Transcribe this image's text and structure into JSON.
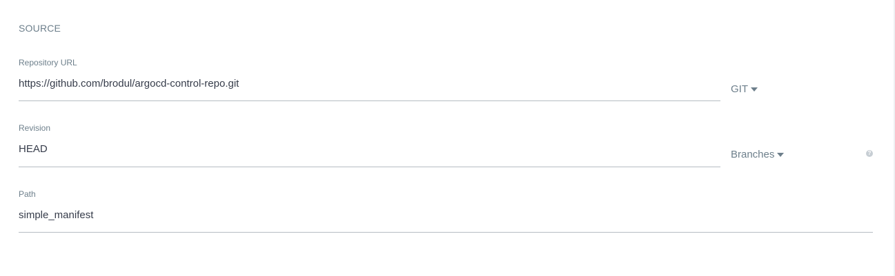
{
  "section": {
    "title": "SOURCE"
  },
  "fields": {
    "repo_url": {
      "label": "Repository URL",
      "value": "https://github.com/brodul/argocd-control-repo.git"
    },
    "revision": {
      "label": "Revision",
      "value": "HEAD"
    },
    "path": {
      "label": "Path",
      "value": "simple_manifest"
    }
  },
  "repo_type_dropdown": {
    "selected": "GIT",
    "icon": "caret-down-icon"
  },
  "revision_type_dropdown": {
    "selected": "Branches",
    "icon": "caret-down-icon"
  },
  "help": {
    "icon": "question-circle-icon",
    "glyph": "?"
  },
  "colors": {
    "label": "#6d7f8b",
    "value": "#363c4a",
    "underline": "#b5bcc2",
    "help_icon": "#c7ced4"
  }
}
